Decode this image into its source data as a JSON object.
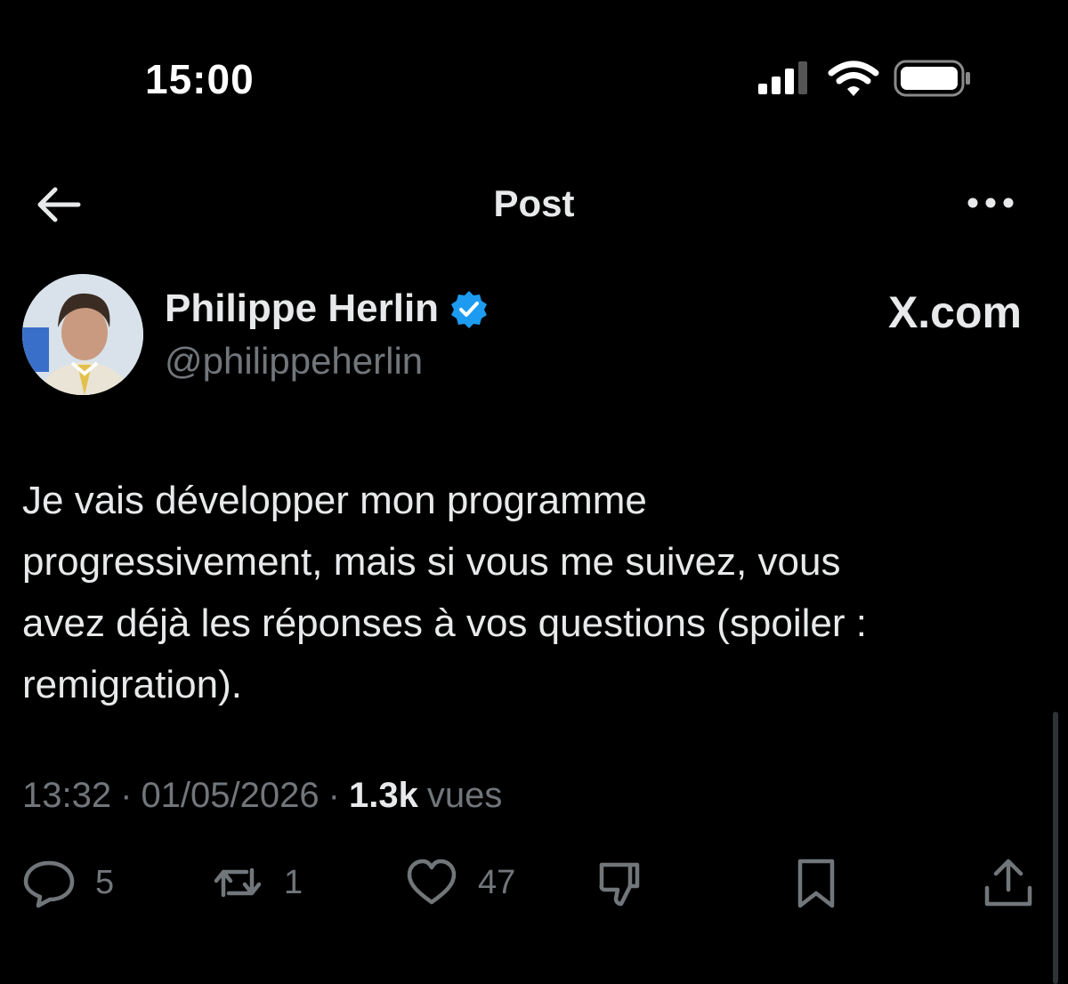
{
  "status_bar": {
    "time": "15:00",
    "icons": [
      "cellular-signal-icon",
      "wifi-icon",
      "battery-icon"
    ]
  },
  "nav": {
    "title": "Post",
    "back_icon": "arrow-left-icon",
    "more_icon": "more-horizontal-icon"
  },
  "author": {
    "name": "Philippe Herlin",
    "handle": "@philippeherlin",
    "verified_icon": "verified-badge-icon",
    "verified_color": "#1d9bf0"
  },
  "watermark": "X.com",
  "post": {
    "text": "Je vais développer mon programme\nprogressivement, mais si vous me suivez, vous\navez déjà les réponses à vos questions (spoiler :\nremigration)."
  },
  "meta": {
    "time": "13:32",
    "date": "01/05/2026",
    "views_count": "1.3k",
    "views_label": "vues",
    "separator": "·"
  },
  "actions": {
    "replies": "5",
    "reposts": "1",
    "likes": "47"
  },
  "colors": {
    "background": "#000000",
    "text": "#e7e9ea",
    "muted": "#71767b",
    "accent": "#1d9bf0"
  }
}
